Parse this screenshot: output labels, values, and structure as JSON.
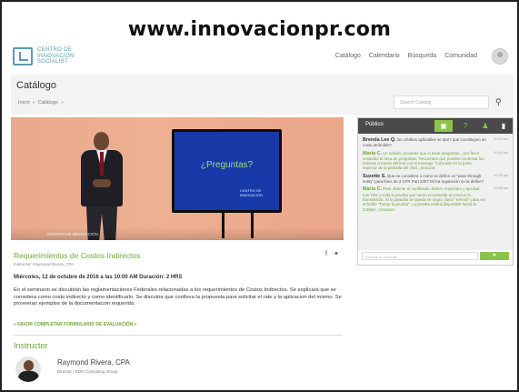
{
  "banner": {
    "url": "www.innovacionpr.com"
  },
  "logo": {
    "line1": "CENTRO DE",
    "line2": "INNOVACIÓN",
    "line3": "SOCIALIST"
  },
  "nav": {
    "items": [
      "Catálogo",
      "Calendario",
      "Búsqueda",
      "Comunidad"
    ]
  },
  "page": {
    "title": "Catálogo"
  },
  "breadcrumb": {
    "home": "Inicio",
    "current": "Catálogo"
  },
  "search": {
    "placeholder": "Search Catalog"
  },
  "video": {
    "screen_text": "¿Preguntas?",
    "screen_logo_line1": "CENTRO DE",
    "screen_logo_line2": "INNOVACIÓN",
    "caption": "CENTRO DE INNOVACIÓN"
  },
  "chat": {
    "tab_label": "Público",
    "messages": [
      {
        "author": "Brenda Lee Q.",
        "text": "los créditos aplicables se dan? qué constituyen un costo atribuible?",
        "time": "10:00 am",
        "style": "normal"
      },
      {
        "author": "María C.",
        "text": "Un saludo, recuerde que si tiene preguntas... por favor enviarlas al área de preguntas. Recuerden que pueden contestar las mismas a través del link con el mensaje \"colocado en la parte superior de la pantalla del chat. ¡Gracias!",
        "time": "10:04 am",
        "style": "green"
      },
      {
        "author": "Suzette S.",
        "text": "Que se considera o como se define un \"pass through entity\" para fines de 2 CFR Part 200? Dicha regulación no la define?",
        "time": "10:08 am",
        "style": "normal"
      },
      {
        "author": "María C.",
        "text": "Para obtener el certificado, deben responder y aprobar con 70% o más la prueba que verán en pantalla al concluir la transmisión. Si la pantalla se queda en negro, favor \"refresh\" para ver el botón \"Tomar la prueba\". La prueba estará disponible hasta la 2:30pm. ¡Gracias!",
        "time": "10:48 am",
        "style": "green"
      }
    ],
    "input_placeholder": "Escriba su mensaje",
    "send_label": "➤"
  },
  "course": {
    "title": "Requerimientos de Costos Indirectos",
    "instructor_line": "Instructor: Raymond Rivera, CPA",
    "date_line": "Miércoles, 12 de octubre de 2016 a las 10:00 AM Duración: 2 HRS",
    "description": "En el seminario se discutirán las reglamentaciones Federales relacionadas a los requerimientos de Costos Indirectos. Se explicará que se considera como costo indirecto y como identificarlo. Se discutira que conlleva la propuesta para solicitar el rate y la aplicacion del mismo. Se proveeran ejemplos de la documentacion requerida.",
    "form_link": "» FAVOR COMPLETAR FORMULARIO DE EVALUACIÓN «"
  },
  "instructor": {
    "heading": "Instructor",
    "name": "Raymond Rivera, CPA",
    "role": "Director | EDN Consulting Group"
  },
  "colors": {
    "accent": "#8bc34a",
    "accent_text": "#6aa83a",
    "tv_blue": "#173aa8",
    "backdrop": "#eba78a"
  }
}
